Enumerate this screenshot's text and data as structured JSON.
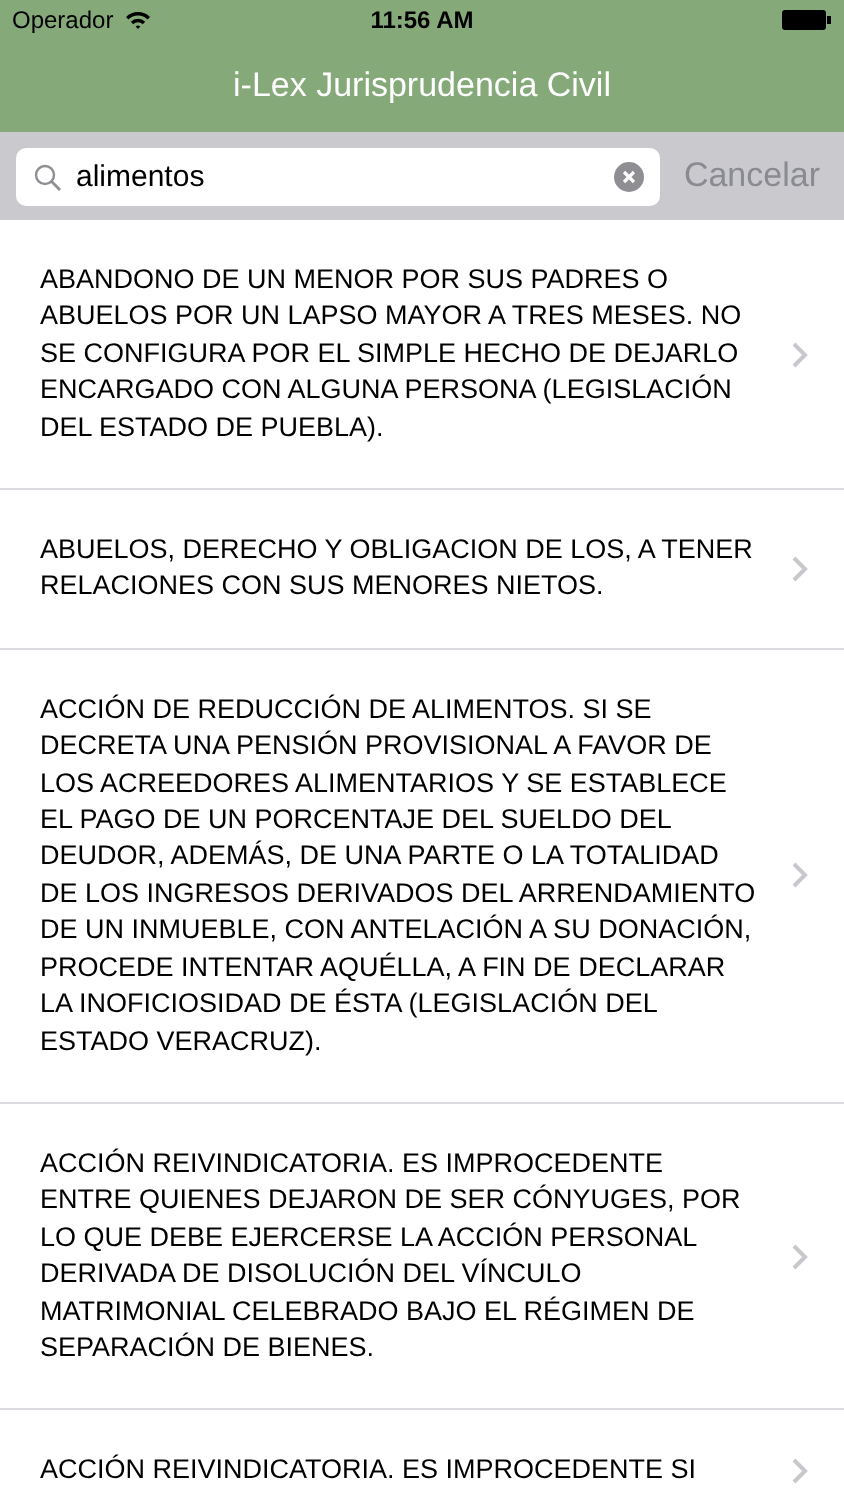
{
  "status_bar": {
    "carrier": "Operador",
    "time": "11:56 AM"
  },
  "nav_bar": {
    "title": "i-Lex Jurisprudencia Civil"
  },
  "search": {
    "value": "alimentos",
    "cancel": "Cancelar"
  },
  "results": [
    {
      "text": "ABANDONO DE UN MENOR POR SUS PADRES O ABUELOS POR UN LAPSO MAYOR A TRES MESES. NO SE CONFIGURA POR EL SIMPLE HECHO DE DEJARLO ENCARGADO CON ALGUNA PERSONA (LEGISLACIÓN DEL ESTADO DE PUEBLA)."
    },
    {
      "text": "ABUELOS, DERECHO Y OBLIGACION DE LOS, A TENER RELACIONES CON SUS MENORES NIETOS."
    },
    {
      "text": "ACCIÓN DE REDUCCIÓN DE ALIMENTOS. SI SE DECRETA UNA PENSIÓN PROVISIONAL A FAVOR DE LOS ACREEDORES ALIMENTARIOS Y SE ESTABLECE EL PAGO DE UN PORCENTAJE DEL SUELDO DEL DEUDOR, ADEMÁS, DE UNA PARTE O LA TOTALIDAD DE LOS INGRESOS DERIVADOS DEL ARRENDAMIENTO DE UN INMUEBLE, CON ANTELACIÓN A SU DONACIÓN, PROCEDE INTENTAR AQUÉLLA, A FIN DE DECLARAR LA INOFICIOSIDAD DE ÉSTA (LEGISLACIÓN DEL ESTADO VERACRUZ)."
    },
    {
      "text": "ACCIÓN REIVINDICATORIA. ES IMPROCEDENTE ENTRE QUIENES DEJARON DE SER CÓNYUGES, POR LO QUE DEBE EJERCERSE LA ACCIÓN PERSONAL DERIVADA DE DISOLUCIÓN DEL VÍNCULO MATRIMONIAL CELEBRADO BAJO EL RÉGIMEN DE SEPARACIÓN DE BIENES."
    },
    {
      "text": "ACCIÓN REIVINDICATORIA. ES IMPROCEDENTE SI"
    }
  ]
}
